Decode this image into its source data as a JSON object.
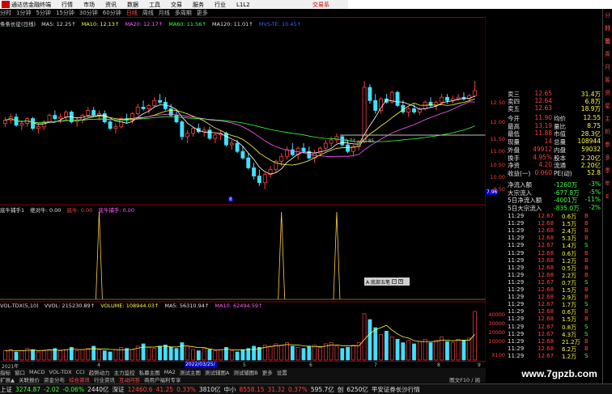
{
  "menubar": {
    "app": "通达信金融终端",
    "items": [
      "行情",
      "市场",
      "资讯",
      "数据",
      "工具",
      "交易",
      "服务",
      "行业",
      "L1L2"
    ],
    "title": "交易系"
  },
  "periods": {
    "items": [
      "分时",
      "1分钟",
      "5分钟",
      "15分钟",
      "30分钟",
      "60分钟",
      "日线",
      "周线",
      "月线",
      "多周期",
      "更多"
    ],
    "active": 6
  },
  "legend1": {
    "name": "条条长征(日线)",
    "ma5": "MA5: 12.25↑",
    "ma10": "MA10: 12.13↑",
    "ma20": "MA20: 12.17↑",
    "ma60": "MA60: 11.56↑",
    "ma120": "MA120: 11.01↑",
    "mvs": "MVS-TE: 10.45↑"
  },
  "axis1": [
    "12.50",
    "12.00",
    "11.50",
    "11.00",
    "10.50",
    "10.00",
    "9.50"
  ],
  "price_tag": "7.96",
  "range_label": "10.74 - 10.85",
  "low_marker": "8",
  "pane2": {
    "name": "底牛捕手1",
    "a": "绝对牛: 0.00",
    "b": "底牛: 0.00",
    "c": "底牛捕手: 0.00"
  },
  "pane3": {
    "name": "VOL-TDX(5,10)",
    "vvol": "VVOL: 215230.89↑",
    "vol": "VOLUME: 108944.03↑",
    "ma5": "MA5: 56310.94↑",
    "ma10": "MA10: 62494.59↑"
  },
  "axis3": [
    "40000",
    "30000",
    "20000",
    "10000",
    "X100"
  ],
  "popup": {
    "label": "A 底部五笔"
  },
  "datebar": {
    "year": "2021年",
    "highlight": "2022/03/25/五",
    "months": [
      "4",
      "5",
      "6",
      "7",
      "8",
      "9"
    ]
  },
  "bottomtabs": [
    "指标",
    "窗口",
    "MACD",
    "VOL-TDX",
    "CCI",
    "趋势动力",
    "主力监控",
    "私募主图",
    "MA2",
    "测试主图",
    "测试辅图A",
    "测试辅图B",
    "更多",
    "设置"
  ],
  "infotabs": {
    "items": [
      "扩展▲",
      "关联报价",
      "资金分布",
      "综合资讯",
      "行业资讯",
      "互动问答",
      "商用户福利专享"
    ],
    "right": "图文F10 / 阅"
  },
  "quote": {
    "levels": [
      [
        "卖三",
        "12.65",
        "31.4万"
      ],
      [
        "卖四",
        "12.64",
        "6.8万"
      ],
      [
        "卖五",
        "12.63",
        "18.9万"
      ]
    ],
    "stats": [
      [
        "今开",
        "11.90",
        "均价",
        "12.55"
      ],
      [
        "最高",
        "13.19",
        "量比",
        "8.75"
      ],
      [
        "最低",
        "11.88",
        "市值",
        "28.3亿"
      ],
      [
        "现量",
        "14",
        "总量",
        "108944"
      ],
      [
        "外盘",
        "49912",
        "内盘",
        "59032"
      ],
      [
        "换手",
        "4.95%",
        "股本",
        "2.20亿"
      ],
      [
        "净资",
        "4.20",
        "流通",
        "2.20亿"
      ],
      [
        "收益(一)",
        "0.060",
        "PE(动)",
        "52.8"
      ]
    ],
    "flows": [
      [
        "净流入额",
        "-1260万",
        "-3%"
      ],
      [
        "大宗流入",
        "-677.8万",
        "-5%"
      ],
      [
        "5日净流入额",
        "-4001万",
        "-11%"
      ],
      [
        "5日大宗流入",
        "-835.0万",
        "-2%"
      ]
    ],
    "ticks": [
      [
        "11:29",
        "12.67",
        "0.6万",
        "B"
      ],
      [
        "11:29",
        "12.68",
        "1.5万",
        "B"
      ],
      [
        "11:29",
        "12.68",
        "2.4万",
        "B"
      ],
      [
        "11:29",
        "12.68",
        "5.3万",
        "B"
      ],
      [
        "11:29",
        "12.67",
        "1.4万",
        "S"
      ],
      [
        "11:29",
        "12.68",
        "0.6万",
        "B"
      ],
      [
        "11:29",
        "12.68",
        "1.2万",
        "B"
      ],
      [
        "11:29",
        "12.68",
        "0.5万",
        "B"
      ],
      [
        "11:29",
        "12.68",
        "2.2万",
        "B"
      ],
      [
        "11:29",
        "12.67",
        "0.7万",
        "S"
      ],
      [
        "11:29",
        "12.68",
        "1.5万",
        "B"
      ],
      [
        "11:29",
        "12.68",
        "2.9万",
        "B"
      ],
      [
        "11:29",
        "12.67",
        "1.7万",
        "S"
      ],
      [
        "11:29",
        "12.68",
        "0.6万",
        "B"
      ],
      [
        "11:29",
        "12.68",
        "1.5万",
        "B"
      ],
      [
        "11:29",
        "12.67",
        "0.8万",
        "S"
      ],
      [
        "11:29",
        "12.67",
        "4.3万",
        "S"
      ],
      [
        "11:29",
        "12.68",
        "21.2万",
        "B"
      ],
      [
        "11:29",
        "12.68",
        "6.2万",
        "B"
      ],
      [
        "11:29",
        "12.67",
        "1.2万",
        "S"
      ]
    ]
  },
  "sidebar": [
    "分时",
    "分笔",
    "日",
    "周",
    "月",
    "筹",
    "资",
    "星",
    "主",
    "析",
    "参",
    "多",
    "季",
    "年",
    "E"
  ],
  "statusbar": {
    "sh_name": "上证",
    "sh_val": "3274.87",
    "sh_chg": "-2.02",
    "sh_pct": "-0.06%",
    "sh_amt": "2440亿",
    "sz_name": "深证",
    "sz_val": "12460.6",
    "sz_chg": "41.25",
    "sz_pct": "0.33%",
    "sz_amt": "3810亿",
    "zx_name": "中小",
    "zx_val": "8558.15",
    "zx_chg": "31.32",
    "zx_pct": "0.37%",
    "zx_amt": "595.7亿",
    "cy_name": "创",
    "cy_amt": "6250亿",
    "feed": "平安证券长沙行情"
  },
  "watermark": "www.7gpzb.com",
  "colors": {
    "up": "#ff4040",
    "down": "#40e0ff",
    "ma5": "#ffffff",
    "ma10": "#ffff40",
    "ma20": "#ff60ff",
    "ma60": "#40ff40"
  },
  "chart_data": {
    "type": "candlestick",
    "note_axis": "price",
    "ylim": [
      9.3,
      12.8
    ],
    "ohlc": [
      [
        11.6,
        11.8,
        11.5,
        11.7
      ],
      [
        11.7,
        11.9,
        11.6,
        11.8
      ],
      [
        11.8,
        11.9,
        11.5,
        11.55
      ],
      [
        11.55,
        11.7,
        11.4,
        11.6
      ],
      [
        11.6,
        11.8,
        11.5,
        11.75
      ],
      [
        11.75,
        11.8,
        11.4,
        11.45
      ],
      [
        11.45,
        11.6,
        11.3,
        11.5
      ],
      [
        11.5,
        11.7,
        11.4,
        11.65
      ],
      [
        11.65,
        11.9,
        11.6,
        11.85
      ],
      [
        11.85,
        12.0,
        11.7,
        11.75
      ],
      [
        11.75,
        11.9,
        11.6,
        11.8
      ],
      [
        11.8,
        12.0,
        11.7,
        11.95
      ],
      [
        11.95,
        12.0,
        11.6,
        11.65
      ],
      [
        11.65,
        11.8,
        11.5,
        11.7
      ],
      [
        11.7,
        11.9,
        11.6,
        11.85
      ],
      [
        11.85,
        12.1,
        11.8,
        12.0
      ],
      [
        12.0,
        12.1,
        11.8,
        11.85
      ],
      [
        11.85,
        12.0,
        11.7,
        11.9
      ],
      [
        11.9,
        12.0,
        11.6,
        11.65
      ],
      [
        11.65,
        11.7,
        11.4,
        11.45
      ],
      [
        11.45,
        11.6,
        11.3,
        11.5
      ],
      [
        11.5,
        11.8,
        11.45,
        11.75
      ],
      [
        11.75,
        11.9,
        11.6,
        11.7
      ],
      [
        11.7,
        11.95,
        11.6,
        11.9
      ],
      [
        11.9,
        12.2,
        11.85,
        12.1
      ],
      [
        12.1,
        12.3,
        12.0,
        12.05
      ],
      [
        12.05,
        12.2,
        11.9,
        12.15
      ],
      [
        12.15,
        12.4,
        12.1,
        12.3
      ],
      [
        12.3,
        12.5,
        12.2,
        12.25
      ],
      [
        12.25,
        12.4,
        12.0,
        12.05
      ],
      [
        12.05,
        12.2,
        11.8,
        11.85
      ],
      [
        11.85,
        12.0,
        11.6,
        11.65
      ],
      [
        11.65,
        11.7,
        11.1,
        11.2
      ],
      [
        11.2,
        11.4,
        11.0,
        11.3
      ],
      [
        11.3,
        11.5,
        11.2,
        11.45
      ],
      [
        11.45,
        11.6,
        11.3,
        11.35
      ],
      [
        11.35,
        11.5,
        11.2,
        11.4
      ],
      [
        11.4,
        11.5,
        11.1,
        11.15
      ],
      [
        11.15,
        11.3,
        11.0,
        11.25
      ],
      [
        11.25,
        11.4,
        11.1,
        11.3
      ],
      [
        11.3,
        11.35,
        10.9,
        10.95
      ],
      [
        10.95,
        11.1,
        10.8,
        11.0
      ],
      [
        11.0,
        11.1,
        10.7,
        10.75
      ],
      [
        10.75,
        10.9,
        10.5,
        10.55
      ],
      [
        10.55,
        10.7,
        10.2,
        10.25
      ],
      [
        10.25,
        10.4,
        9.9,
        10.0
      ],
      [
        10.0,
        10.2,
        9.7,
        9.8
      ],
      [
        9.8,
        10.1,
        9.6,
        10.05
      ],
      [
        10.05,
        10.3,
        9.95,
        10.2
      ],
      [
        10.2,
        10.5,
        10.1,
        10.45
      ],
      [
        10.45,
        10.7,
        10.3,
        10.6
      ],
      [
        10.6,
        10.9,
        10.5,
        10.8
      ],
      [
        10.8,
        11.0,
        10.6,
        10.65
      ],
      [
        10.65,
        10.9,
        10.5,
        10.85
      ],
      [
        10.85,
        11.0,
        10.7,
        10.75
      ],
      [
        10.75,
        10.9,
        10.5,
        10.55
      ],
      [
        10.55,
        10.8,
        10.4,
        10.7
      ],
      [
        10.7,
        10.9,
        10.6,
        10.85
      ],
      [
        10.85,
        11.1,
        10.8,
        11.0
      ],
      [
        11.0,
        11.2,
        10.9,
        11.1
      ],
      [
        11.1,
        11.3,
        11.0,
        11.2
      ],
      [
        11.2,
        11.25,
        10.9,
        10.95
      ],
      [
        10.95,
        11.1,
        10.7,
        10.75
      ],
      [
        10.75,
        10.95,
        10.6,
        10.9
      ],
      [
        10.9,
        11.1,
        10.8,
        11.05
      ],
      [
        11.05,
        12.9,
        11.0,
        12.7
      ],
      [
        12.7,
        12.8,
        12.2,
        12.3
      ],
      [
        12.3,
        12.5,
        11.9,
        12.0
      ],
      [
        12.0,
        12.4,
        11.9,
        12.35
      ],
      [
        12.35,
        12.5,
        12.2,
        12.25
      ],
      [
        12.25,
        12.6,
        12.2,
        12.55
      ],
      [
        12.55,
        12.6,
        12.1,
        12.15
      ],
      [
        12.15,
        12.3,
        11.9,
        11.95
      ],
      [
        11.95,
        12.1,
        11.8,
        12.05
      ],
      [
        12.05,
        12.2,
        11.9,
        11.95
      ],
      [
        11.95,
        12.1,
        11.85,
        12.05
      ],
      [
        12.05,
        12.3,
        12.0,
        12.25
      ],
      [
        12.25,
        12.4,
        12.1,
        12.15
      ],
      [
        12.15,
        12.3,
        12.0,
        12.25
      ],
      [
        12.25,
        12.5,
        12.2,
        12.4
      ],
      [
        12.4,
        12.5,
        12.2,
        12.3
      ],
      [
        12.3,
        12.45,
        12.2,
        12.35
      ],
      [
        12.35,
        12.5,
        12.3,
        12.4
      ],
      [
        12.4,
        12.55,
        12.3,
        12.35
      ],
      [
        12.35,
        12.5,
        12.25,
        12.45
      ],
      [
        12.45,
        12.9,
        12.4,
        12.6
      ]
    ],
    "signals": [
      17,
      50,
      60
    ],
    "volume": [
      8,
      9,
      7,
      8,
      10,
      9,
      7,
      8,
      9,
      10,
      8,
      9,
      11,
      8,
      9,
      10,
      12,
      9,
      8,
      7,
      9,
      11,
      10,
      9,
      12,
      14,
      11,
      10,
      12,
      13,
      11,
      10,
      15,
      12,
      9,
      8,
      10,
      9,
      8,
      9,
      11,
      8,
      7,
      9,
      10,
      12,
      11,
      13,
      12,
      14,
      13,
      15,
      12,
      11,
      10,
      12,
      13,
      11,
      14,
      15,
      12,
      10,
      11,
      13,
      15,
      40,
      35,
      28,
      22,
      25,
      20,
      18,
      15,
      17,
      14,
      16,
      18,
      15,
      17,
      20,
      16,
      15,
      18,
      17,
      19,
      42
    ]
  }
}
